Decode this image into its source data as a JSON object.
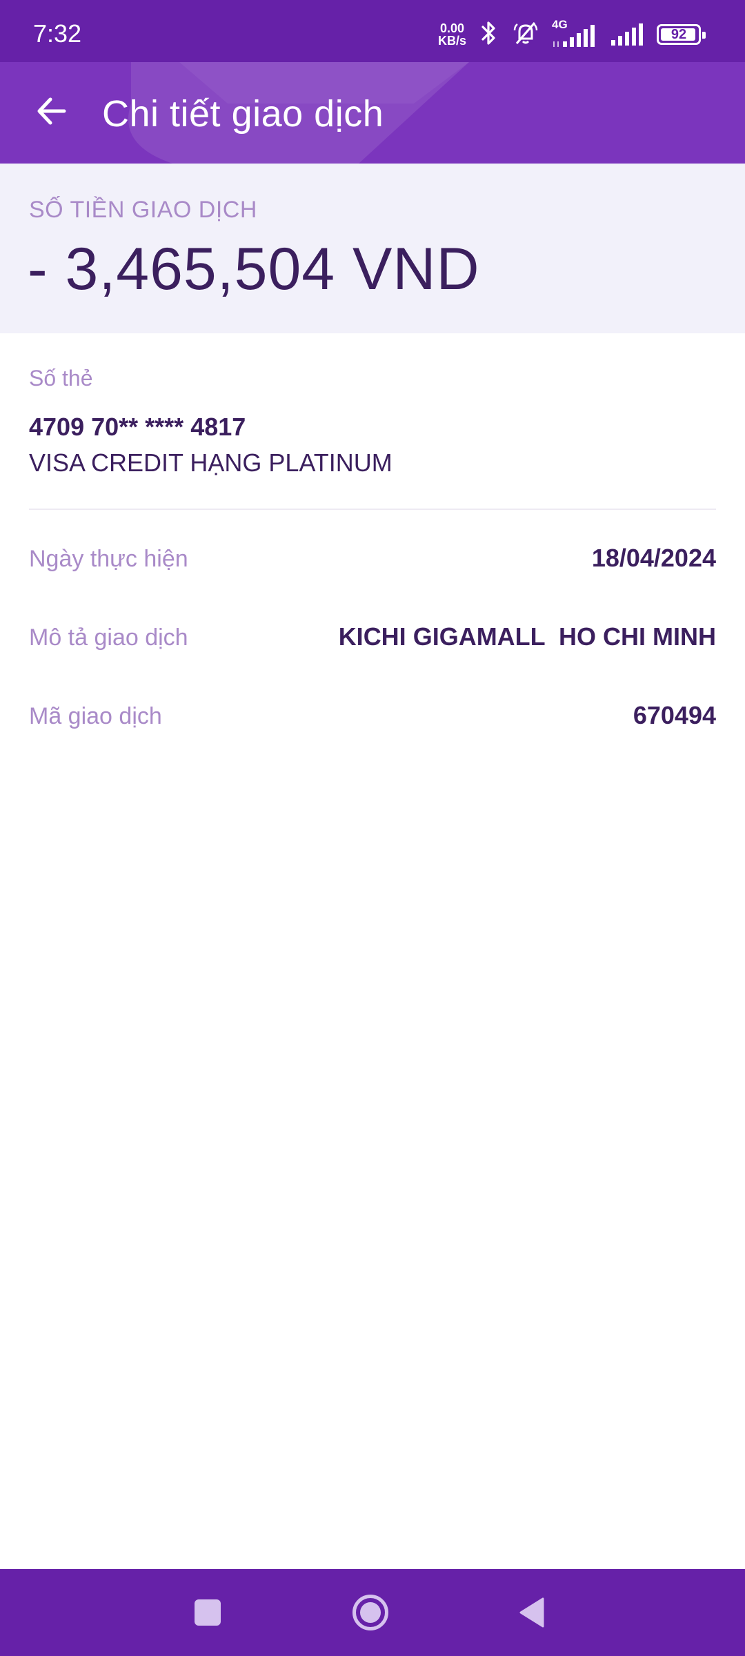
{
  "status_bar": {
    "time": "7:32",
    "net_speed_value": "0.00",
    "net_speed_unit": "KB/s",
    "network_type": "4G",
    "battery_level": "92",
    "icons": [
      "bluetooth-icon",
      "bell-off-icon",
      "signal-icon",
      "signal-icon",
      "battery-icon"
    ]
  },
  "header": {
    "title": "Chi tiết giao dịch",
    "back_icon": "arrow-left-icon"
  },
  "amount": {
    "label": "SỐ TIỀN GIAO DỊCH",
    "value": "- 3,465,504 VND"
  },
  "card": {
    "label": "Số thẻ",
    "number": "4709 70** **** 4817",
    "type": "VISA CREDIT HẠNG PLATINUM"
  },
  "details": [
    {
      "label": "Ngày thực hiện",
      "value": "18/04/2024"
    },
    {
      "label": "Mô tả giao dịch",
      "value": "KICHI GIGAMALL  HO CHI MINH"
    },
    {
      "label": "Mã giao dịch",
      "value": "670494"
    }
  ],
  "nav_bar": {
    "recents_icon": "square-icon",
    "home_icon": "circle-icon",
    "back_icon": "triangle-back-icon"
  },
  "colors": {
    "status_bar_bg": "#6621a8",
    "header_bg": "#7b35bd",
    "amount_bg": "#f2f1fa",
    "label_text": "#a98ac8",
    "value_text": "#3b1f5e"
  }
}
